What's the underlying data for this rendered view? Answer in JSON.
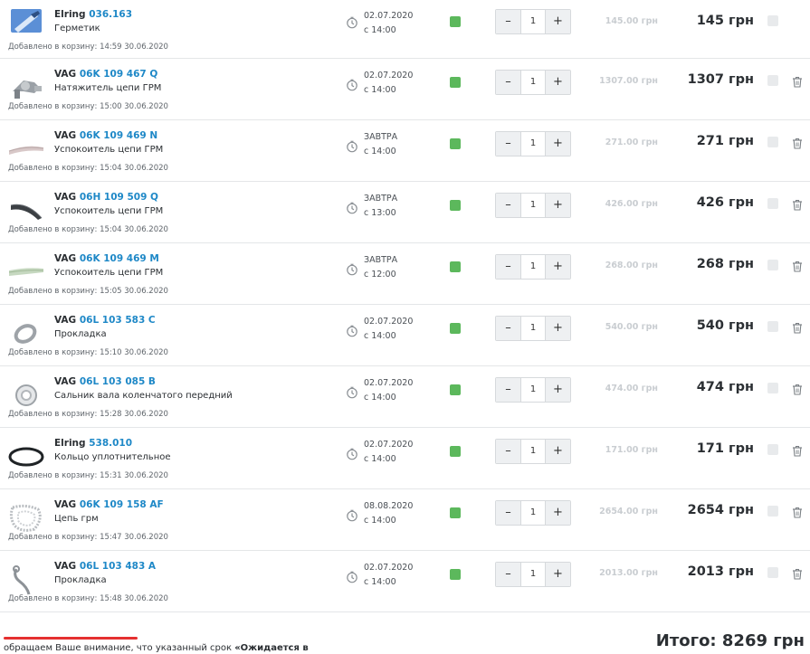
{
  "cart": {
    "items": [
      {
        "brand": "Elring",
        "code": "036.163",
        "name": "Герметик",
        "date": "02.07.2020",
        "time": "с 14:00",
        "unit_price": "145.00 грн",
        "qty": "1",
        "total": "145 грн",
        "added_label": "Добавлено в корзину:",
        "added_at": "14:59 30.06.2020",
        "icon": "sealant-tube"
      },
      {
        "brand": "VAG",
        "code": "06K 109 467 Q",
        "name": "Натяжитель цепи ГРМ",
        "date": "02.07.2020",
        "time": "с 14:00",
        "unit_price": "1307.00 грн",
        "qty": "1",
        "total": "1307 грн",
        "added_label": "Добавлено в корзину:",
        "added_at": "15:00 30.06.2020",
        "icon": "chain-tensioner"
      },
      {
        "brand": "VAG",
        "code": "06K 109 469 N",
        "name": "Успокоитель цепи ГРМ",
        "date": "ЗАВТРА",
        "time": "с 14:00",
        "unit_price": "271.00 грн",
        "qty": "1",
        "total": "271 грн",
        "added_label": "Добавлено в корзину:",
        "added_at": "15:04 30.06.2020",
        "icon": "chain-guide"
      },
      {
        "brand": "VAG",
        "code": "06H 109 509 Q",
        "name": "Успокоитель цепи ГРМ",
        "date": "ЗАВТРА",
        "time": "с 13:00",
        "unit_price": "426.00 грн",
        "qty": "1",
        "total": "426 грн",
        "added_label": "Добавлено в корзину:",
        "added_at": "15:04 30.06.2020",
        "icon": "chain-guide-dark"
      },
      {
        "brand": "VAG",
        "code": "06K 109 469 M",
        "name": "Успокоитель цепи ГРМ",
        "date": "ЗАВТРА",
        "time": "с 12:00",
        "unit_price": "268.00 грн",
        "qty": "1",
        "total": "268 грн",
        "added_label": "Добавлено в корзину:",
        "added_at": "15:05 30.06.2020",
        "icon": "chain-guide-green"
      },
      {
        "brand": "VAG",
        "code": "06L 103 583 C",
        "name": "Прокладка",
        "date": "02.07.2020",
        "time": "с 14:00",
        "unit_price": "540.00 грн",
        "qty": "1",
        "total": "540 грн",
        "added_label": "Добавлено в корзину:",
        "added_at": "15:10 30.06.2020",
        "icon": "gasket"
      },
      {
        "brand": "VAG",
        "code": "06L 103 085 B",
        "name": "Сальник вала коленчатого передний",
        "date": "02.07.2020",
        "time": "с 14:00",
        "unit_price": "474.00 грн",
        "qty": "1",
        "total": "474 грн",
        "added_label": "Добавлено в корзину:",
        "added_at": "15:28 30.06.2020",
        "icon": "shaft-seal"
      },
      {
        "brand": "Elring",
        "code": "538.010",
        "name": "Кольцо уплотнительное",
        "date": "02.07.2020",
        "time": "с 14:00",
        "unit_price": "171.00 грн",
        "qty": "1",
        "total": "171 грн",
        "added_label": "Добавлено в корзину:",
        "added_at": "15:31 30.06.2020",
        "icon": "o-ring"
      },
      {
        "brand": "VAG",
        "code": "06K 109 158 AF",
        "name": "Цепь грм",
        "date": "08.08.2020",
        "time": "с 14:00",
        "unit_price": "2654.00 грн",
        "qty": "1",
        "total": "2654 грн",
        "added_label": "Добавлено в корзину:",
        "added_at": "15:47 30.06.2020",
        "icon": "timing-chain"
      },
      {
        "brand": "VAG",
        "code": "06L 103 483 A",
        "name": "Прокладка",
        "date": "02.07.2020",
        "time": "с 14:00",
        "unit_price": "2013.00 грн",
        "qty": "1",
        "total": "2013 грн",
        "added_label": "Добавлено в корзину:",
        "added_at": "15:48 30.06.2020",
        "icon": "gasket-hose"
      }
    ]
  },
  "controls": {
    "minus": "–",
    "plus": "+"
  },
  "footer": {
    "notice_text": "обращаем Ваше внимание, что указанный срок ",
    "notice_bold": "«Ожидается в",
    "grand_total": "Итого: 8269 грн"
  },
  "colors": {
    "available": "#5cb85c",
    "link": "#1e88c7"
  }
}
